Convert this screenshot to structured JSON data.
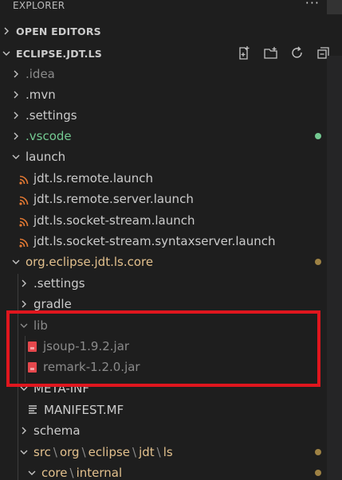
{
  "explorer": {
    "title": "EXPLORER",
    "more": "···"
  },
  "sections": {
    "open_editors": "OPEN EDITORS",
    "project": "ECLIPSE.JDT.LS"
  },
  "toolbar": {
    "new_file_icon": "new-file-icon",
    "new_folder_icon": "new-folder-icon",
    "refresh_icon": "refresh-icon",
    "collapse_icon": "collapse-all-icon"
  },
  "tree": {
    "idea": ".idea",
    "mvn": ".mvn",
    "settings": ".settings",
    "vscode": ".vscode",
    "launch": "launch",
    "launch_files": [
      "jdt.ls.remote.launch",
      "jdt.ls.remote.server.launch",
      "jdt.ls.socket-stream.launch",
      "jdt.ls.socket-stream.syntaxserver.launch"
    ],
    "core": "org.eclipse.jdt.ls.core",
    "core_settings": ".settings",
    "gradle": "gradle",
    "lib": "lib",
    "jars": [
      "jsoup-1.9.2.jar",
      "remark-1.2.0.jar"
    ],
    "meta_inf": "META-INF",
    "manifest": "MANIFEST.MF",
    "schema": "schema",
    "src_path": [
      "src",
      "org",
      "eclipse",
      "jdt",
      "ls"
    ],
    "core_internal": [
      "core",
      "internal"
    ]
  },
  "colors": {
    "modified": "#e2c08d",
    "untracked": "#73c991",
    "highlight_border": "#e0161e",
    "jar": "#e5484d",
    "rss": "#e37933"
  }
}
